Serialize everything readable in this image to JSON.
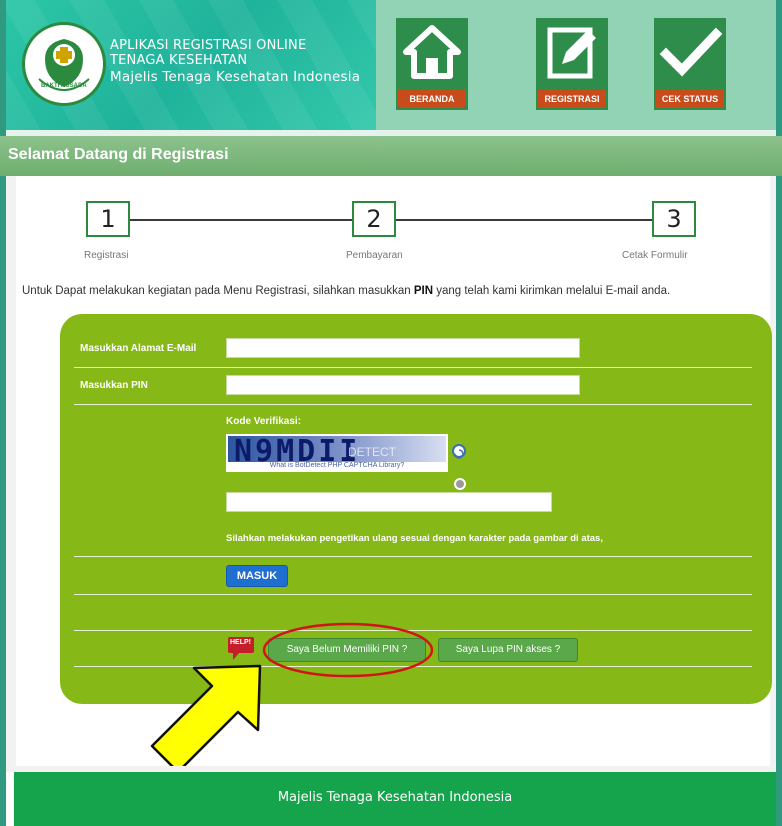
{
  "header": {
    "title_line1": "APLIKASI REGISTRASI ONLINE",
    "title_line2": "TENAGA KESEHATAN",
    "subtitle": "Majelis Tenaga Kesehatan Indonesia",
    "logo_text": "BAKTI HUSADA",
    "nav": [
      {
        "label": "BERANDA",
        "icon": "home-icon"
      },
      {
        "label": "REGISTRASI",
        "icon": "edit-icon"
      },
      {
        "label": "CEK STATUS",
        "icon": "check-icon"
      }
    ]
  },
  "welcome_title": "Selamat Datang di Registrasi",
  "steps": [
    {
      "number": "1",
      "label": "Registrasi"
    },
    {
      "number": "2",
      "label": "Pembayaran"
    },
    {
      "number": "3",
      "label": "Cetak Formulir"
    }
  ],
  "intro": {
    "before": "Untuk Dapat melakukan kegiatan pada Menu Registrasi, silahkan masukkan ",
    "bold": "PIN",
    "after": " yang telah kami kirimkan melalui E-mail anda."
  },
  "form": {
    "email_label": "Masukkan Alamat E-Mail",
    "email_value": "",
    "pin_label": "Masukkan PIN",
    "pin_value": "",
    "verify_label": "Kode Verifikasi:",
    "captcha_code": "N9MDII",
    "captcha_watermark": "DETECT",
    "captcha_caption": "What is BotDetect PHP CAPTCHA Library?",
    "verify_value": "",
    "hint": "Silahkan melakukan pengetikan ulang sesuai dengan karakter pada gambar di atas,",
    "submit_label": "MASUK",
    "help_label": "HELP!",
    "no_pin_label": "Saya Belum Memiliki PIN ?",
    "forgot_pin_label": "Saya Lupa PIN akses ?"
  },
  "footer_text": "Majelis Tenaga Kesehatan Indonesia",
  "colors": {
    "panel_green": "#86b817",
    "header_teal": "#2cc6a6",
    "nav_green": "#2f8d4b",
    "nav_label": "#c84b1c",
    "footer_green": "#15a44c",
    "highlight_red": "#d0141a",
    "arrow_yellow": "#ffff00"
  }
}
